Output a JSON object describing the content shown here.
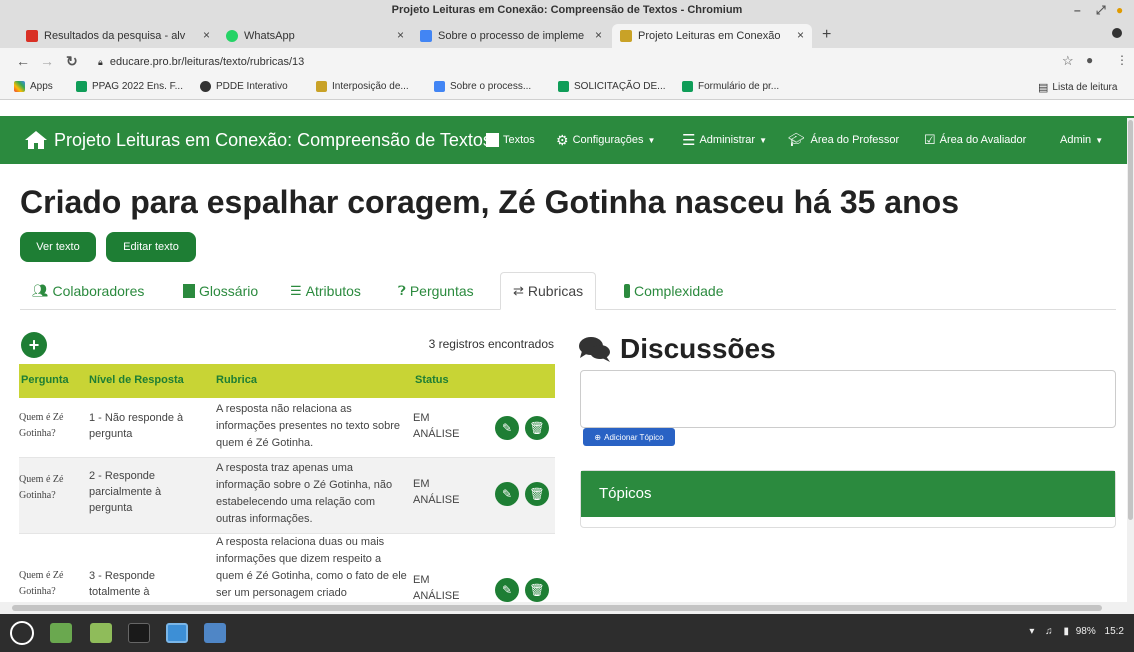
{
  "window": {
    "title": "Projeto Leituras em Conexão: Compreensão de Textos - Chromium"
  },
  "tabs": [
    {
      "label": "Resultados da pesquisa - alv",
      "icon": "gmail-icon"
    },
    {
      "label": "WhatsApp",
      "icon": "whatsapp-icon"
    },
    {
      "label": "Sobre o processo de impleme",
      "icon": "docs-icon"
    },
    {
      "label": "Projeto Leituras em Conexão",
      "icon": "site-icon"
    }
  ],
  "address": {
    "url": "educare.pro.br/leituras/texto/rubricas/13"
  },
  "bookmarks": [
    {
      "label": "Apps"
    },
    {
      "label": "PPAG 2022 Ens. F..."
    },
    {
      "label": "PDDE Interativo"
    },
    {
      "label": "Interposição de..."
    },
    {
      "label": "Sobre o process..."
    },
    {
      "label": "SOLICITAÇÃO DE..."
    },
    {
      "label": "Formulário de pr..."
    }
  ],
  "reading_list": "Lista de leitura",
  "navbar": {
    "brand": "Projeto Leituras em Conexão: Compreensão de Textos",
    "textos": "Textos",
    "configuracoes": "Configurações",
    "administrar": "Administrar",
    "area_professor": "Área do Professor",
    "area_avaliador": "Área do Avaliador",
    "admin": "Admin"
  },
  "page": {
    "title": "Criado para espalhar coragem, Zé Gotinha nasceu há 35 anos",
    "ver_texto": "Ver texto",
    "editar_texto": "Editar texto"
  },
  "page_tabs": {
    "colaboradores": "Colaboradores",
    "glossario": "Glossário",
    "atributos": "Atributos",
    "perguntas": "Perguntas",
    "rubricas": "Rubricas",
    "complexidade": "Complexidade"
  },
  "table": {
    "count": "3 registros encontrados",
    "headers": {
      "pergunta": "Pergunta",
      "nivel": "Nível de Resposta",
      "rubrica": "Rubrica",
      "status": "Status"
    },
    "rows": [
      {
        "pergunta": "Quem é Zé Gotinha?",
        "nivel": "1 - Não responde à pergunta",
        "rubrica": "A resposta não relaciona as informações presentes no texto sobre quem é Zé Gotinha.",
        "status": "EM ANÁLISE"
      },
      {
        "pergunta": "Quem é Zé Gotinha?",
        "nivel": "2 - Responde parcialmente à pergunta",
        "rubrica": "A resposta traz apenas uma informação sobre o Zé Gotinha, não estabelecendo uma relação com outras informações.",
        "status": "EM ANÁLISE"
      },
      {
        "pergunta": "Quem é Zé Gotinha?",
        "nivel": "3 - Responde totalmente à",
        "rubrica": "A resposta relaciona duas ou mais informações que dizem respeito a quem é Zé Gotinha, como o fato de ele ser um personagem criado",
        "status": "EM ANÁLISE"
      }
    ]
  },
  "discussions": {
    "title": "Discussões",
    "add_topic": "Adicionar Tópico",
    "topics_header": "Tópicos"
  },
  "taskbar": {
    "battery": "98%",
    "clock": "15:2"
  },
  "colors": {
    "brand_green": "#2b8a3e",
    "button_green": "#1e7e34",
    "table_header": "#c8d435",
    "add_topic_blue": "#2962c4"
  }
}
